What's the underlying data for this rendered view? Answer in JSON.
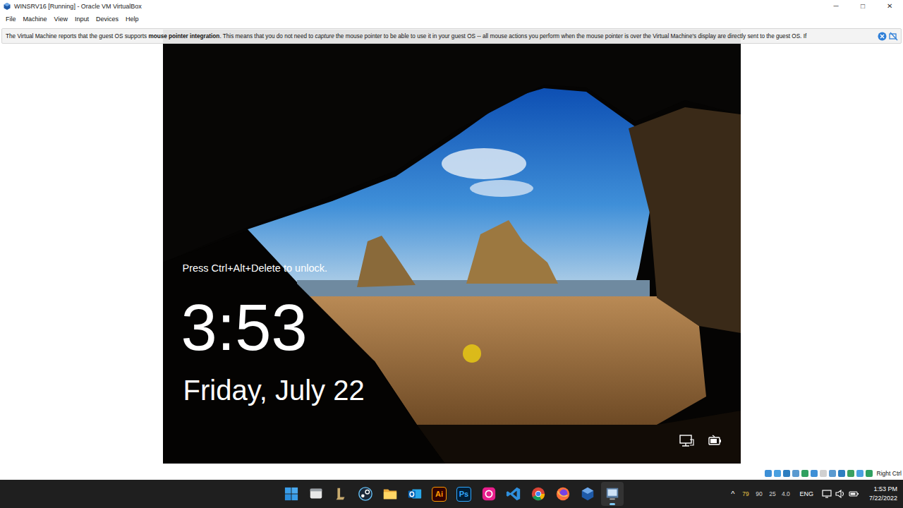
{
  "window": {
    "title": "WINSRV16 [Running] - Oracle VM VirtualBox",
    "controls": [
      "─",
      "□",
      "✕"
    ]
  },
  "menu": [
    "File",
    "Machine",
    "View",
    "Input",
    "Devices",
    "Help"
  ],
  "notification": {
    "parts": [
      {
        "kind": "normal",
        "text": "The Virtual Machine reports that the guest OS supports "
      },
      {
        "kind": "bold",
        "text": "mouse pointer integration"
      },
      {
        "kind": "normal",
        "text": ". This means that you do not need to "
      },
      {
        "kind": "italic",
        "text": "capture"
      },
      {
        "kind": "normal",
        "text": " the mouse pointer to be able to use it in your guest OS -- all mouse actions you perform when the mouse pointer is over the Virtual Machine's display are directly sent to the guest OS. If"
      }
    ]
  },
  "lock_screen": {
    "prompt": "Press Ctrl+Alt+Delete to unlock.",
    "time": "3:53",
    "date": "Friday, July 22"
  },
  "status_bar": {
    "host_key": "Right Ctrl"
  },
  "taskbar": {
    "apps": [
      {
        "kind": "start",
        "active": false
      },
      {
        "kind": "explorer-window",
        "active": false
      },
      {
        "kind": "league",
        "active": false
      },
      {
        "kind": "steam",
        "active": false
      },
      {
        "kind": "folder",
        "active": false
      },
      {
        "kind": "outlook",
        "active": false
      },
      {
        "kind": "illustrator",
        "label": "Ai",
        "active": false
      },
      {
        "kind": "photoshop",
        "label": "Ps",
        "active": false
      },
      {
        "kind": "pink",
        "active": false
      },
      {
        "kind": "vscode",
        "active": false
      },
      {
        "kind": "chrome",
        "active": false
      },
      {
        "kind": "firefox",
        "active": false
      },
      {
        "kind": "virtualbox",
        "active": false
      },
      {
        "kind": "vm",
        "active": true
      }
    ],
    "tray": {
      "chevron": "^",
      "readings": [
        {
          "text": "79",
          "color": "#e8c547"
        },
        {
          "text": "90",
          "color": "#d4d4d4"
        },
        {
          "text": "25",
          "color": "#d4d4d4"
        },
        {
          "text": "4.0",
          "color": "#d4d4d4"
        }
      ],
      "language": "ENG",
      "time": "1:53 PM",
      "date": "7/22/2022"
    }
  }
}
